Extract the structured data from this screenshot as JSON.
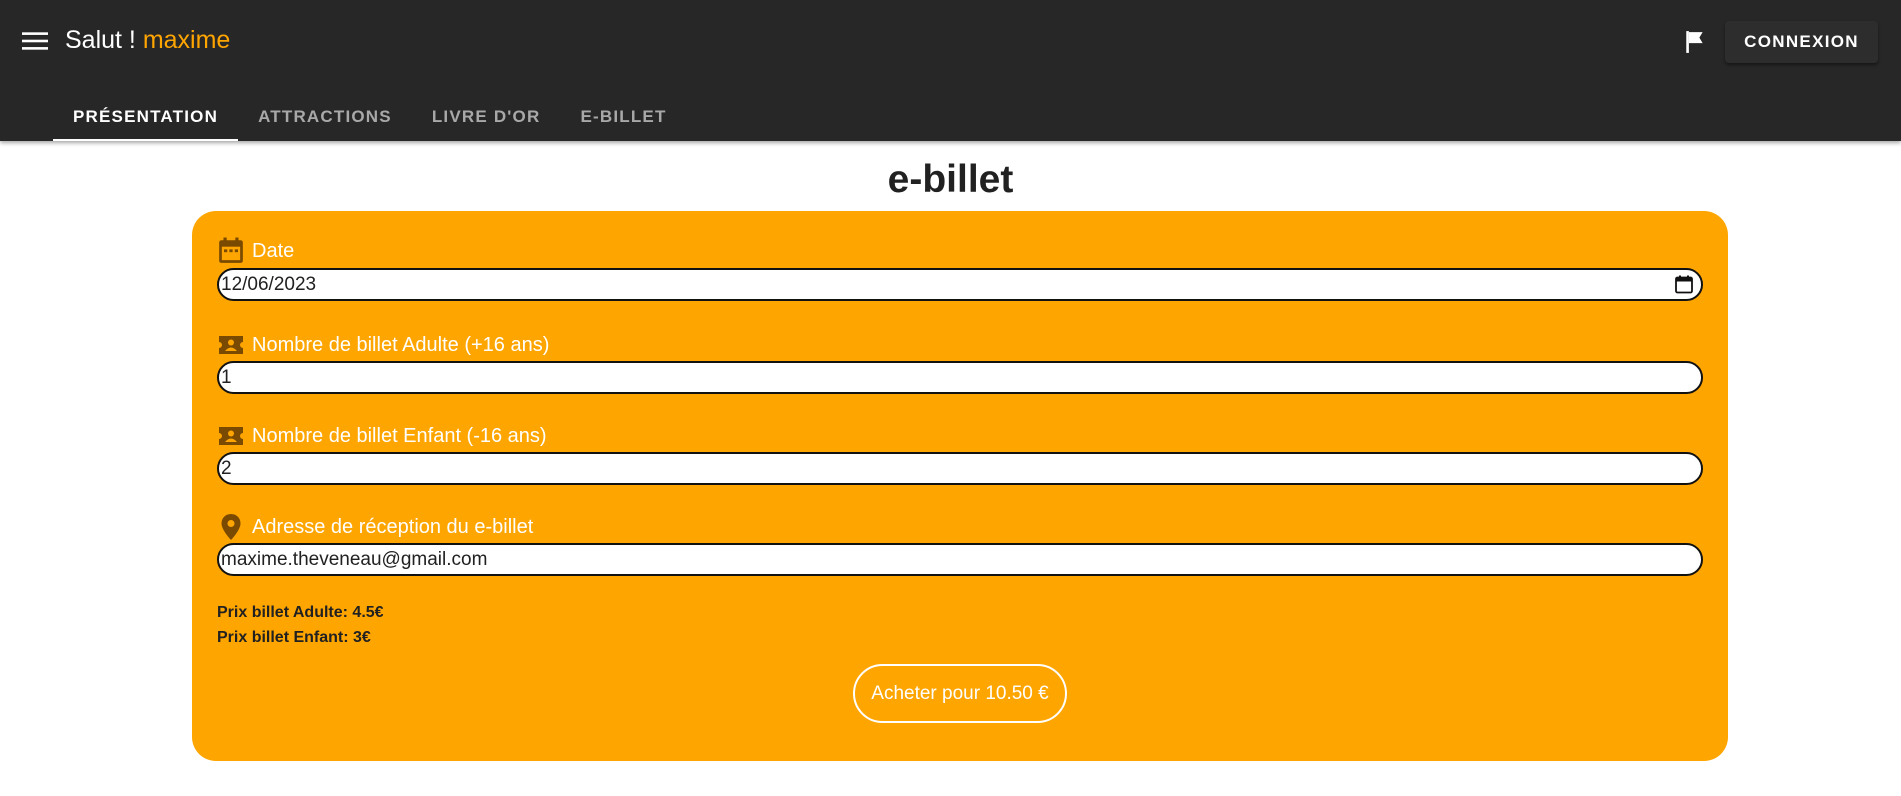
{
  "header": {
    "greeting": "Salut !",
    "username": "maxime",
    "login_label": "CONNEXION",
    "menu_icon": "menu-icon",
    "flag_icon": "flag-icon"
  },
  "tabs": [
    {
      "label": "PRÉSENTATION",
      "active": true
    },
    {
      "label": "ATTRACTIONS",
      "active": false
    },
    {
      "label": "LIVRE D'OR",
      "active": false
    },
    {
      "label": "E-BILLET",
      "active": false
    }
  ],
  "page": {
    "title": "e-billet"
  },
  "form": {
    "date": {
      "label": "Date",
      "value": "12/06/2023",
      "icon": "calendar-icon"
    },
    "adult": {
      "label": "Nombre de billet Adulte (+16 ans)",
      "value": "1",
      "icon": "ticket-icon"
    },
    "child": {
      "label": "Nombre de billet Enfant (-16 ans)",
      "value": "2",
      "icon": "ticket-icon"
    },
    "email": {
      "label": "Adresse de réception du e-billet",
      "value": "maxime.theveneau@gmail.com",
      "icon": "location-pin-icon"
    },
    "price_adult": "Prix billet Adulte: 4.5€",
    "price_child": "Prix billet Enfant: 3€",
    "buy_label": "Acheter pour 10.50 €"
  },
  "colors": {
    "appbar": "#272727",
    "accent": "#ffa500",
    "icon_dark": "#7a4a00"
  }
}
